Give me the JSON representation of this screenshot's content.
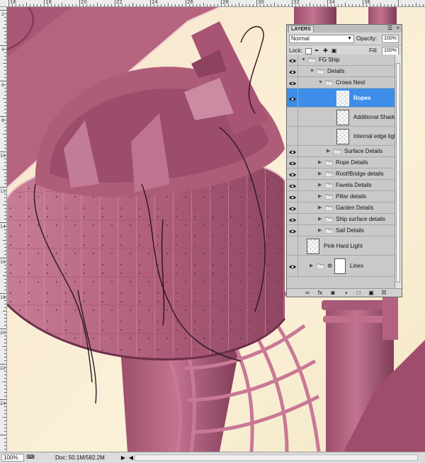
{
  "rulers": {
    "top_labels": [
      "16",
      "18",
      "20",
      "22",
      "24",
      "26",
      "28",
      "30",
      "32",
      "34",
      "36"
    ],
    "left_labels": [
      "2",
      "4",
      "6",
      "8",
      "10",
      "12",
      "14",
      "16",
      "18",
      "20",
      "22",
      "24"
    ]
  },
  "status_bar": {
    "zoom": "100%",
    "doc_info": "Doc: 50.1M/582.2M"
  },
  "layers_panel": {
    "tab_label": "LAYERS",
    "menu_icon": "panel-menu-icon",
    "close_icon": "close-icon",
    "blend_mode": "Normal",
    "opacity_label": "Opacity:",
    "opacity_value": "100%",
    "lock_label": "Lock:",
    "fill_label": "Fill:",
    "fill_value": "100%",
    "layers": [
      {
        "name": "FG Ship",
        "kind": "group",
        "depth": 0,
        "expanded": true,
        "visible": true
      },
      {
        "name": "Details",
        "kind": "group",
        "depth": 1,
        "expanded": true,
        "visible": true
      },
      {
        "name": "Crows Nest",
        "kind": "group",
        "depth": 2,
        "expanded": true,
        "visible": true
      },
      {
        "name": "Ropes",
        "kind": "layer",
        "depth": 3,
        "visible": true,
        "selected": true
      },
      {
        "name": "Additional Shadows",
        "kind": "layer",
        "depth": 3,
        "visible": false
      },
      {
        "name": "Internal edge lighting",
        "kind": "layer",
        "depth": 3,
        "visible": false
      },
      {
        "name": "Surface Details",
        "kind": "group",
        "depth": 3,
        "expanded": false,
        "visible": true
      },
      {
        "name": "Rope Details",
        "kind": "group",
        "depth": 2,
        "expanded": false,
        "visible": true
      },
      {
        "name": "Roof/Bridge details",
        "kind": "group",
        "depth": 2,
        "expanded": false,
        "visible": true
      },
      {
        "name": "Favela Details",
        "kind": "group",
        "depth": 2,
        "expanded": false,
        "visible": true
      },
      {
        "name": "Pillar details",
        "kind": "group",
        "depth": 2,
        "expanded": false,
        "visible": true
      },
      {
        "name": "Garden Details",
        "kind": "group",
        "depth": 2,
        "expanded": false,
        "visible": true
      },
      {
        "name": "Ship surface details",
        "kind": "group",
        "depth": 2,
        "expanded": false,
        "visible": true
      },
      {
        "name": "Sail Details",
        "kind": "group",
        "depth": 2,
        "expanded": false,
        "visible": true
      },
      {
        "name": "Pink Hard Light",
        "kind": "layer",
        "depth": 0,
        "visible": false
      },
      {
        "name": "Lines",
        "kind": "masked-group",
        "depth": 1,
        "expanded": false,
        "visible": true
      }
    ],
    "footer_icons": [
      "link-layers-icon",
      "layer-style-icon",
      "add-mask-icon",
      "adjustment-layer-icon",
      "new-group-icon",
      "new-layer-icon",
      "delete-layer-icon"
    ]
  },
  "colors": {
    "selection": "#3d8ee9",
    "ship_base": "#b9637e",
    "background": "#f7ecd1"
  }
}
